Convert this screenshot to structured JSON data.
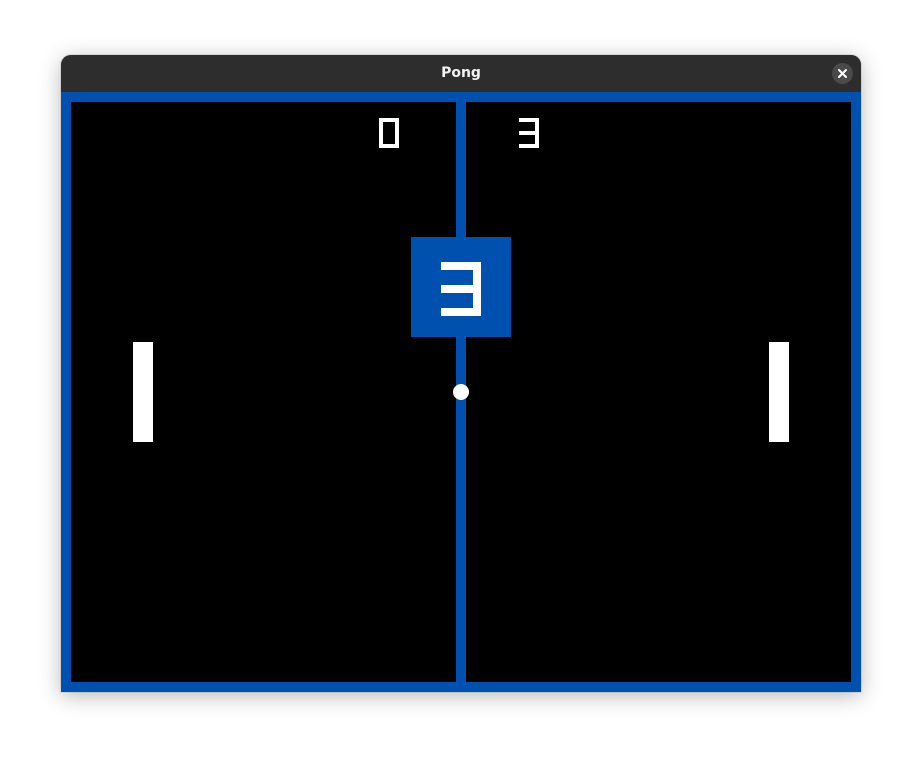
{
  "window": {
    "title": "Pong",
    "close_icon": "close-icon"
  },
  "game": {
    "score_left": "0",
    "score_right": "3",
    "countdown": "3",
    "colors": {
      "frame": "#0050b0",
      "court": "#000000",
      "foreground": "#ffffff",
      "titlebar": "#2d2d2d"
    }
  }
}
